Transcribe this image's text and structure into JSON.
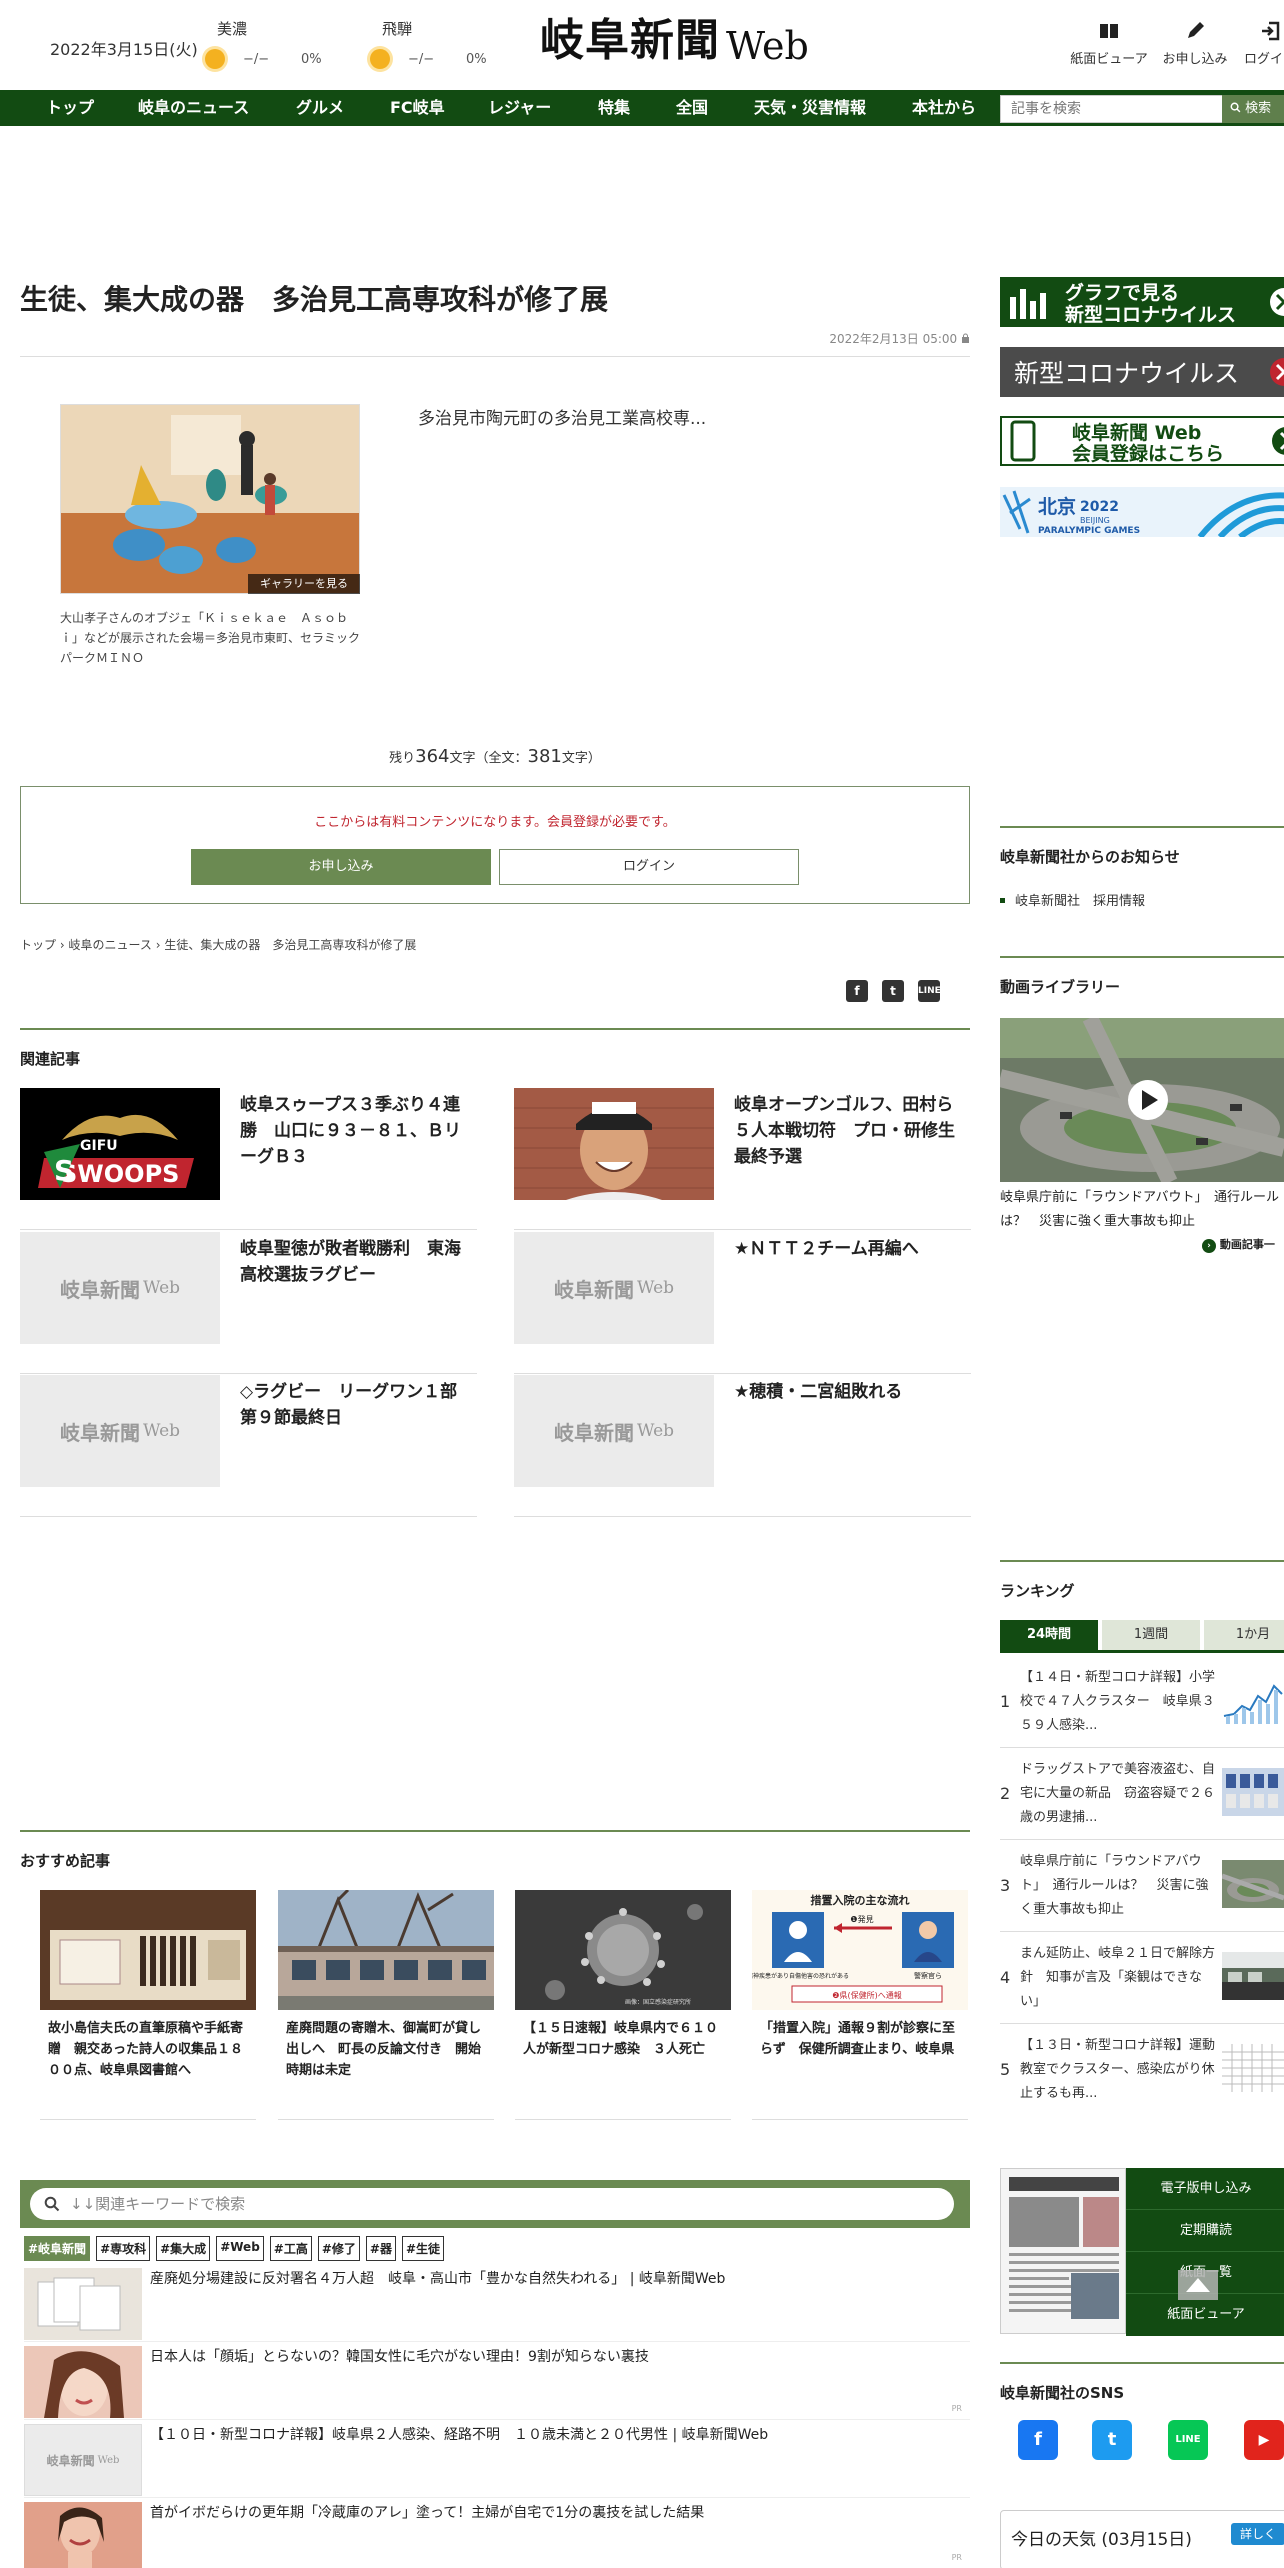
{
  "header": {
    "date": "2022年3月15日(火)",
    "weather": [
      {
        "region": "美濃",
        "temp": "−/−",
        "rain": "0%"
      },
      {
        "region": "飛騨",
        "temp": "−/−",
        "rain": "0%"
      }
    ],
    "logo_main": "岐阜新聞",
    "logo_web": "Web",
    "links": [
      "紙面ビューア",
      "お申し込み",
      "ログイン"
    ]
  },
  "nav": {
    "items": [
      "トップ",
      "岐阜のニュース",
      "グルメ",
      "FC岐阜",
      "レジャー",
      "特集",
      "全国",
      "天気・災害情報",
      "本社から"
    ],
    "search_placeholder": "記事を検索",
    "search_button": "検索"
  },
  "article": {
    "title": "生徒、集大成の器　多治見工高専攻科が修了展",
    "date": "2022年2月13日 05:00",
    "gallery_label": "ギャラリーを見る",
    "caption": "大山孝子さんのオブジェ「Ｋｉｓｅｋａｅ　Ａｓｏｂｉ」などが展示された会場＝多治見市東町、セラミックパークＭＩＮＯ",
    "lede": "多治見市陶元町の多治見工業高校専...",
    "remaining_prefix": "残り",
    "remaining_count": "364",
    "remaining_mid": "文字（全文：",
    "total_count": "381",
    "remaining_suffix": "文字）",
    "paywall_text": "ここからは有料コンテンツになります。会員登録が必要です。",
    "apply_button": "お申し込み",
    "login_button": "ログイン",
    "breadcrumb": [
      "トップ",
      "岐阜のニュース",
      "生徒、集大成の器　多治見工高専攻科が修了展"
    ]
  },
  "related": {
    "heading": "関連記事",
    "items": [
      {
        "title": "岐阜スゥープス３季ぶり４連勝　山口に９３－８１、ＢリーグＢ３",
        "thumb": "swoops-logo"
      },
      {
        "title": "岐阜オープンゴルフ、田村ら５人本戦切符　プロ・研修生最終予選",
        "thumb": "golfer-photo"
      },
      {
        "title": "岐阜聖徳が敗者戦勝利　東海高校選抜ラグビー",
        "thumb": "placeholder"
      },
      {
        "title": "★ＮＴＴ２チーム再編へ",
        "thumb": "placeholder"
      },
      {
        "title": "◇ラグビー　リーグワン１部第９節最終日",
        "thumb": "placeholder"
      },
      {
        "title": "★穂積・二宮組敗れる",
        "thumb": "placeholder"
      }
    ],
    "placeholder_main": "岐阜新聞",
    "placeholder_web": "Web"
  },
  "recommended": {
    "heading": "おすすめ記事",
    "items": [
      {
        "title": "故小島信夫氏の直筆原稿や手紙寄贈　親交あった詩人の収集品１８００点、岐阜県図書館へ"
      },
      {
        "title": "産廃問題の寄贈木、御嵩町が貸し出しへ　町長の反論文付き　開始時期は未定"
      },
      {
        "title": "【１５日速報】岐阜県内で６１０人が新型コロナ感染　３人死亡"
      },
      {
        "title": "「措置入院」通報９割が診察に至らず　保健所調査止まり、岐阜県"
      }
    ],
    "diagram_title": "措置入院の主な流れ",
    "diagram_step1": "❶発見",
    "diagram_step2": "❷県(保健所)へ通報",
    "diagram_left": "精神疾患があり自傷他害の恐れがある",
    "diagram_right": "警察官ら",
    "virus_credit": "画像：国立感染症研究所"
  },
  "keyword": {
    "placeholder": "↓↓関連キーワードで検索",
    "tags": [
      "#岐阜新聞",
      "#専攻科",
      "#集大成",
      "#Web",
      "#工高",
      "#修了",
      "#器",
      "#生徒"
    ]
  },
  "ads": [
    {
      "title": "産廃処分場建設に反対署名４万人超　岐阜・高山市「豊かな自然失われる」 | 岐阜新聞Web",
      "pr": ""
    },
    {
      "title": "日本人は「顔垢」とらないの？韓国女性に毛穴がない理由！9割が知らない裏技",
      "pr": "PR"
    },
    {
      "title": "【１０日・新型コロナ詳報】岐阜県２人感染、経路不明　１０歳未満と２０代男性 | 岐阜新聞Web",
      "pr": ""
    },
    {
      "title": "首がイボだらけの更年期「冷蔵庫のアレ」塗って！主婦が自宅で1分の裏技を試した結果",
      "pr": "PR"
    }
  ],
  "sidebar": {
    "banners": [
      {
        "label": "グラフで見る\n新型コロナウイルス"
      },
      {
        "label": "新型コロナウイルス"
      },
      {
        "label": "岐阜新聞 Web\n会員登録はこちら"
      },
      {
        "label_main": "北京",
        "label_year": "2022",
        "label_sub1": "BEIJING",
        "label_sub2": "PARALYMPIC GAMES"
      }
    ],
    "notice_heading": "岐阜新聞社からのお知らせ",
    "notice_items": [
      "岐阜新聞社　採用情報"
    ],
    "video_heading": "動画ライブラリー",
    "video_caption": "岐阜県庁前に「ラウンドアバウト」　通行ルールは？　災害に強く重大事故も抑止",
    "video_more": "動画記事一",
    "ranking_heading": "ランキング",
    "ranking_tabs": [
      "24時間",
      "1週間",
      "1か月"
    ],
    "ranking": [
      {
        "rank": "1",
        "title": "【１４日・新型コロナ詳報】小学校で４７人クラスター　岐阜県３５９人感染..."
      },
      {
        "rank": "2",
        "title": "ドラッグストアで美容液盗む、自宅に大量の新品　窃盗容疑で２６歳の男逮捕..."
      },
      {
        "rank": "3",
        "title": "岐阜県庁前に「ラウンドアバウト」　通行ルールは？　災害に強く重大事故も抑止"
      },
      {
        "rank": "4",
        "title": "まん延防止、岐阜２１日で解除方針　知事が言及「楽観はできない」"
      },
      {
        "rank": "5",
        "title": "【１３日・新型コロナ詳報】運動教室でクラスター、感染広がり休止するも再..."
      }
    ],
    "epaper_buttons": [
      "電子版申し込み",
      "定期購読",
      "紙面一覧",
      "紙面ビューア"
    ],
    "sns_heading": "岐阜新聞社のSNS",
    "sns": [
      "f",
      "t",
      "LINE",
      "▶"
    ],
    "weather_box": "今日の天気 (03月15日)",
    "weather_more": "詳しく"
  },
  "colors": {
    "nav_green": "#124b12",
    "accent_green": "#6b8a52",
    "paywall_red": "#c0252f"
  }
}
